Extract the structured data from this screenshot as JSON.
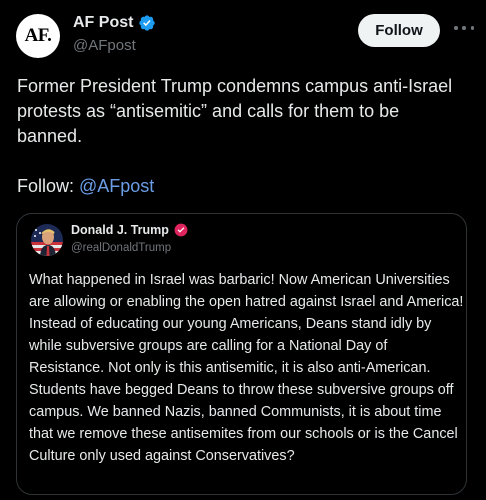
{
  "post": {
    "author": {
      "avatar_text": "AF.",
      "display_name": "AF Post",
      "handle": "@AFpost",
      "verified_icon": "verified-badge-icon",
      "verified_color": "#1d9bf0"
    },
    "follow_button": "Follow",
    "more_icon": "more-options-icon",
    "text": "Former President Trump condemns campus anti-Israel protests as “antisemitic” and calls for them to be banned.",
    "follow_prefix": "Follow: ",
    "follow_link": "@AFpost",
    "link_color": "#6b9de6"
  },
  "quoted": {
    "author": {
      "display_name": "Donald J. Trump",
      "handle": "@realDonaldTrump",
      "badge_icon": "truth-verified-badge-icon",
      "badge_color": "#e0245e"
    },
    "text": "What happened in Israel was barbaric! Now American Universities are allowing or enabling the open hatred against Israel and America! Instead of educating our young Americans, Deans stand idly by while subversive groups are calling for a National Day of Resistance. Not only is this antisemitic, it is also anti-American. Students have begged Deans to throw these subversive groups off campus. We banned Nazis, banned Communists, it is about time that we remove these antisemites from our schools or is the Cancel Culture only used against Conservatives?"
  }
}
